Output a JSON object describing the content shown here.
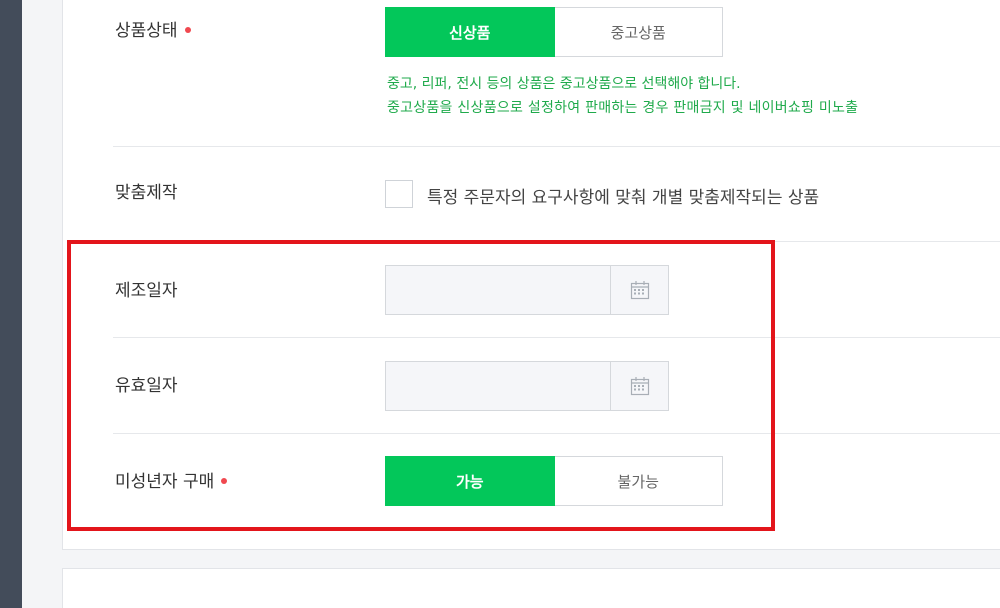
{
  "product_condition": {
    "label": "상품상태",
    "options": [
      "신상품",
      "중고상품"
    ],
    "selected": "신상품",
    "notice": [
      "중고, 리퍼, 전시 등의 상품은 중고상품으로 선택해야 합니다.",
      "중고상품을 신상품으로 설정하여 판매하는 경우 판매금지 및 네이버쇼핑 미노출"
    ]
  },
  "custom_made": {
    "label": "맞춤제작",
    "checkbox_label": "특정 주문자의 요구사항에 맞춰 개별 맞춤제작되는 상품",
    "checked": false
  },
  "manufacture_date": {
    "label": "제조일자",
    "value": "",
    "icon": "calendar-icon"
  },
  "expiry_date": {
    "label": "유효일자",
    "value": "",
    "icon": "calendar-icon"
  },
  "minor_purchase": {
    "label": "미성년자 구매",
    "options": [
      "가능",
      "불가능"
    ],
    "selected": "가능"
  },
  "colors": {
    "accent": "#03c75a",
    "notice": "#1faa4b",
    "required": "#f0484f",
    "highlight": "#e3151b"
  }
}
